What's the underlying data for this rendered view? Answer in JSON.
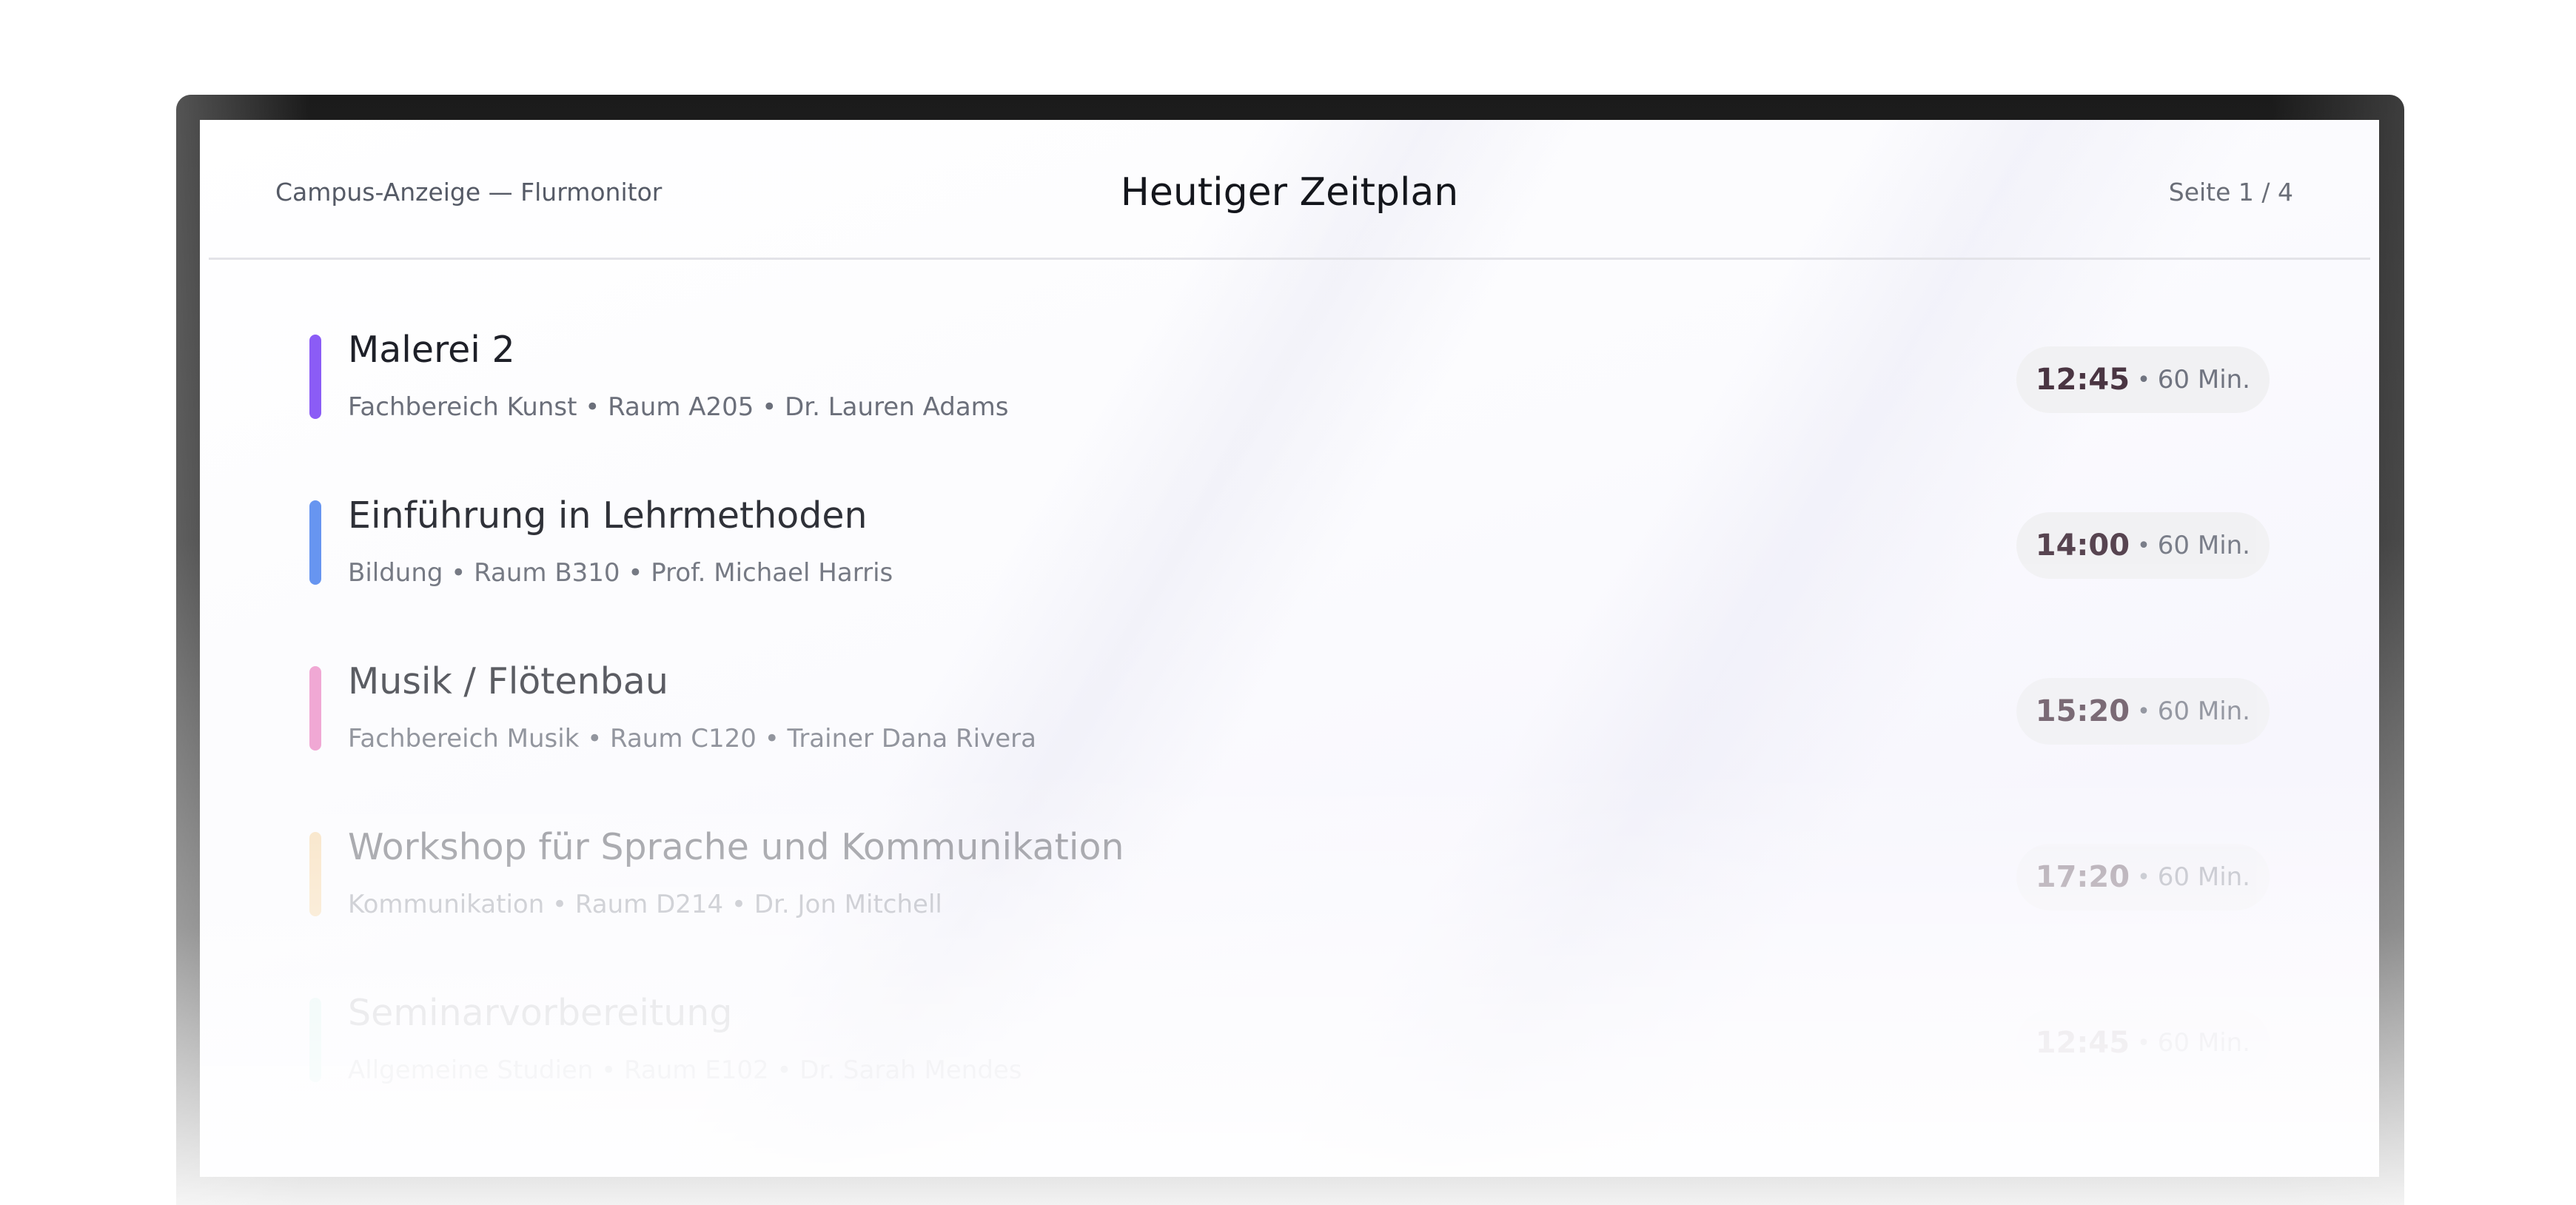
{
  "header": {
    "left_label": "Campus-Anzeige — Flurmonitor",
    "title": "Heutiger Zeitplan",
    "page_indicator": "Seite 1 / 4"
  },
  "separator": "•",
  "schedule": [
    {
      "title": "Malerei 2",
      "meta": "Fachbereich Kunst • Raum A205 • Dr. Lauren Adams",
      "time": "12:45",
      "duration": "60 Min.",
      "accent": "#8b5cf6"
    },
    {
      "title": "Einführung in Lehrmethoden",
      "meta": "Bildung • Raum B310 • Prof. Michael Harris",
      "time": "14:00",
      "duration": "60 Min.",
      "accent": "#5b8def"
    },
    {
      "title": "Musik / Flötenbau",
      "meta": "Fachbereich Musik • Raum C120 • Trainer Dana Rivera",
      "time": "15:20",
      "duration": "60 Min.",
      "accent": "#ec89c4"
    },
    {
      "title": "Workshop für Sprache und Kommunikation",
      "meta": "Kommunikation • Raum D214 • Dr. Jon Mitchell",
      "time": "17:20",
      "duration": "60 Min.",
      "accent": "#f5c77e"
    },
    {
      "title": "Seminarvorbereitung",
      "meta": "Allgemeine Studien • Raum E102 • Dr. Sarah Mendes",
      "time": "12:45",
      "duration": "60 Min.",
      "accent": "#86e0c4"
    }
  ]
}
